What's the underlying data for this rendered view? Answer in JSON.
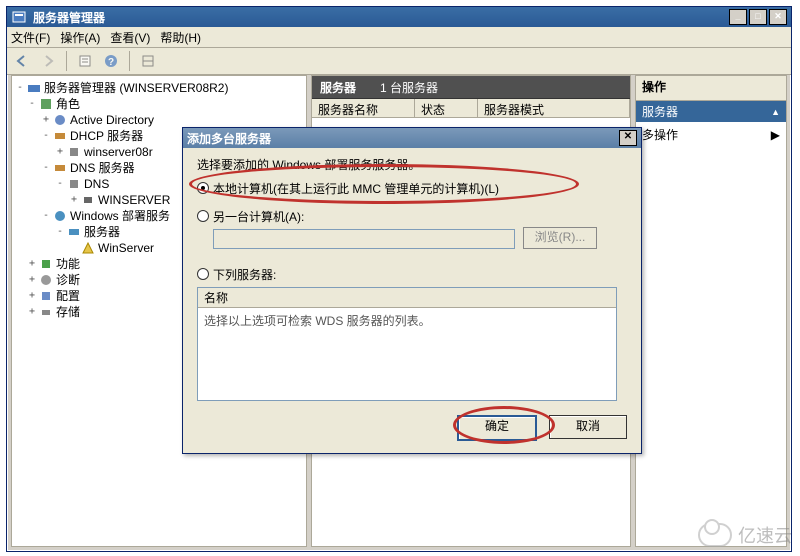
{
  "window": {
    "title": "服务器管理器"
  },
  "menus": {
    "file": "文件(F)",
    "action": "操作(A)",
    "view": "查看(V)",
    "help": "帮助(H)"
  },
  "tree": {
    "root": "服务器管理器 (WINSERVER08R2)",
    "roles": "角色",
    "ad": "Active Directory",
    "dhcp": "DHCP 服务器",
    "dhcp_child": "winserver08r",
    "dns": "DNS 服务器",
    "dns_child": "DNS",
    "dns_grandchild": "WINSERVER",
    "wds": "Windows 部署服务",
    "wds_servers": "服务器",
    "wds_server1": "WinServer",
    "features": "功能",
    "diag": "诊断",
    "config": "配置",
    "storage": "存储"
  },
  "mid": {
    "title": "服务器",
    "count": "1 台服务器",
    "cols": {
      "name": "服务器名称",
      "status": "状态",
      "mode": "服务器模式"
    }
  },
  "actions": {
    "head": "操作",
    "sub": "服务器",
    "more": "多操作"
  },
  "dialog": {
    "title": "添加多台服务器",
    "instr": "选择要添加的 Windows 部署服务服务器。",
    "opt_local": "本地计算机(在其上运行此 MMC 管理单元的计算机)(L)",
    "opt_another": "另一台计算机(A):",
    "browse": "浏览(R)...",
    "opt_following": "下列服务器:",
    "list_header": "名称",
    "list_body": "选择以上选项可检索 WDS 服务器的列表。",
    "ok": "确定",
    "cancel": "取消"
  },
  "watermark": "亿速云"
}
